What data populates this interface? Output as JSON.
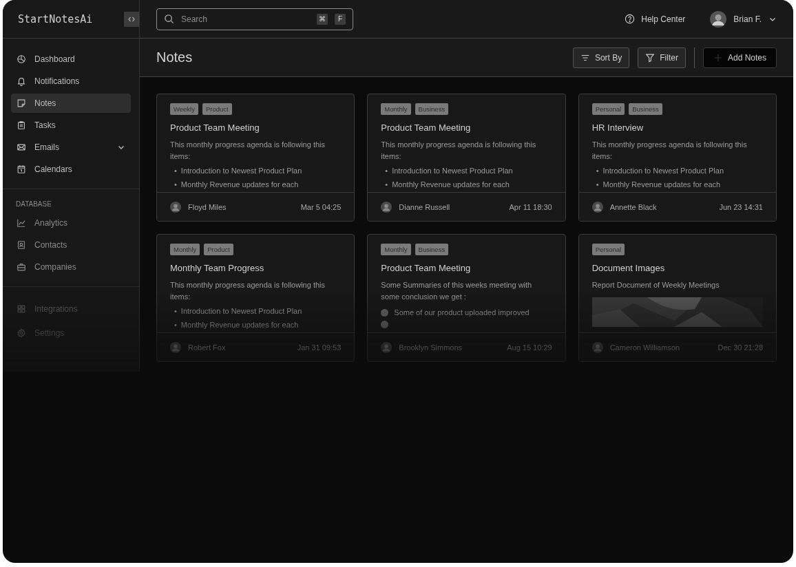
{
  "app": {
    "logo": "StartNotesAi"
  },
  "search": {
    "placeholder": "Search",
    "shortcut_keys": [
      "⌘",
      "F"
    ]
  },
  "header": {
    "help": "Help Center",
    "user": "Brian F."
  },
  "sidebar": {
    "items": [
      {
        "label": "Dashboard",
        "selected": false
      },
      {
        "label": "Notifications",
        "selected": false
      },
      {
        "label": "Notes",
        "selected": true
      },
      {
        "label": "Tasks",
        "selected": false
      },
      {
        "label": "Emails",
        "selected": false,
        "expandable": true
      },
      {
        "label": "Calendars",
        "selected": false
      }
    ],
    "section_title": "DATABASE",
    "database_items": [
      {
        "label": "Analytics",
        "selected": false
      },
      {
        "label": "Contacts",
        "selected": false
      },
      {
        "label": "Companies",
        "selected": false
      }
    ],
    "bottom_items": [
      {
        "label": "Integrations",
        "selected": false
      },
      {
        "label": "Settings",
        "selected": false
      }
    ]
  },
  "page": {
    "title": "Notes",
    "buttons": [
      {
        "label": "Sort By",
        "kind": "sort"
      },
      {
        "label": "Filter",
        "kind": "filter"
      },
      {
        "label": "Add Notes",
        "kind": "add"
      }
    ]
  },
  "notes": [
    {
      "tags": [
        "Weekly",
        "Product"
      ],
      "title": "Product Team Meeting",
      "kind": "bullets",
      "marker": "•",
      "text": "This monthly progress agenda is following this items:",
      "items": [
        "Introduction to Newest Product Plan",
        "Monthly Revenue updates for each"
      ],
      "author": "Floyd Miles",
      "date": "Mar 5 04:25"
    },
    {
      "tags": [
        "Monthly",
        "Business"
      ],
      "title": "Product Team Meeting",
      "kind": "bullets",
      "marker": "•",
      "text": "This monthly progress agenda is following this items:",
      "items": [
        "Introduction to Newest Product Plan",
        "Monthly Revenue updates for each"
      ],
      "author": "Dianne Russell",
      "date": "Apr 11 18:30"
    },
    {
      "tags": [
        "Personal",
        "Business"
      ],
      "title": "HR Interview",
      "kind": "bullets",
      "marker": "•",
      "text": "This monthly progress agenda is following this items:",
      "items": [
        "Introduction to Newest Product Plan",
        "Monthly Revenue updates for each"
      ],
      "author": "Annette Black",
      "date": "Jun 23 14:31"
    },
    {
      "tags": [
        "Monthly",
        "Product"
      ],
      "title": "Monthly Team Progress",
      "kind": "bullets",
      "marker": "•",
      "text": "This monthly progress agenda is following this items:",
      "items": [
        "Introduction to Newest Product Plan",
        "Monthly Revenue updates for each"
      ],
      "author": "Robert Fox",
      "date": "Jan 31 09:53"
    },
    {
      "tags": [
        "Monthly",
        "Business"
      ],
      "title": "Product Team Meeting",
      "kind": "checklist",
      "text": "Some Summaries of this weeks meeting with some conclusion we get :",
      "items": [
        "Some of our product uploaded improved"
      ],
      "author": "Brooklyn Simmons",
      "date": "Aug 15 10:29"
    },
    {
      "tags": [
        "Personal"
      ],
      "title": "Document Images",
      "text": "Report Document of Weekly Meetings",
      "author": "Cameron Williamson",
      "date": "Dec 30 21:28"
    }
  ]
}
